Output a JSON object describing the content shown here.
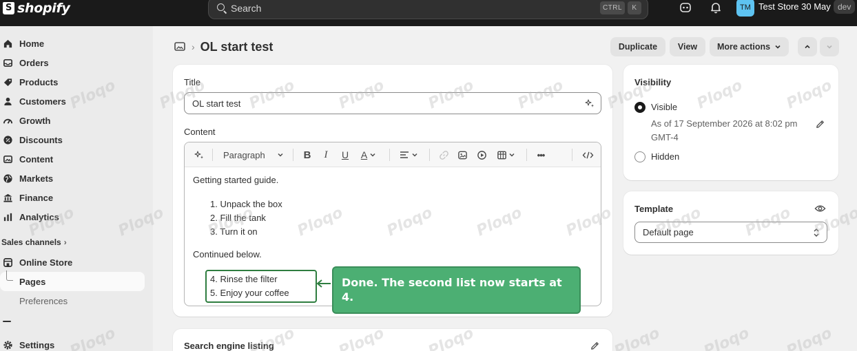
{
  "app": {
    "brand": "shopify"
  },
  "topbar": {
    "search_placeholder": "Search",
    "shortcut_ctrl": "CTRL",
    "shortcut_key": "K",
    "store_initials": "TM",
    "store_name": "Test Store 30 May",
    "badge": "dev"
  },
  "sidebar": {
    "items": [
      {
        "label": "Home",
        "icon": "home-icon"
      },
      {
        "label": "Orders",
        "icon": "inbox-icon"
      },
      {
        "label": "Products",
        "icon": "tag-icon"
      },
      {
        "label": "Customers",
        "icon": "person-icon"
      },
      {
        "label": "Growth",
        "icon": "gauge-icon"
      },
      {
        "label": "Discounts",
        "icon": "discount-icon"
      },
      {
        "label": "Content",
        "icon": "image-icon"
      },
      {
        "label": "Markets",
        "icon": "globe-icon"
      },
      {
        "label": "Finance",
        "icon": "bank-icon"
      },
      {
        "label": "Analytics",
        "icon": "bar-chart-icon"
      }
    ],
    "sales_channels": "Sales channels",
    "online_store": "Online Store",
    "pages": "Pages",
    "preferences": "Preferences",
    "settings": "Settings"
  },
  "header": {
    "title": "OL start test",
    "duplicate": "Duplicate",
    "view": "View",
    "more_actions": "More actions"
  },
  "main": {
    "title_label": "Title",
    "title_value": "OL start test",
    "content_label": "Content",
    "toolbar": {
      "paragraph": "Paragraph",
      "more": "•••"
    },
    "body": {
      "intro": "Getting started guide.",
      "list1": [
        "1. Unpack the box",
        "2. Fill the tank",
        "3. Turn it on"
      ],
      "continued": "Continued below.",
      "list2": [
        "4. Rinse the filter",
        "5. Enjoy your coffee"
      ]
    },
    "seo_title": "Search engine listing"
  },
  "visibility": {
    "title": "Visibility",
    "visible": "Visible",
    "as_of": "As of 17 September 2026 at 8:02 pm",
    "timezone": "GMT-4",
    "hidden": "Hidden"
  },
  "template": {
    "title": "Template",
    "value": "Default page"
  },
  "callout": {
    "text": "Done. The second list now starts at 4."
  },
  "watermark": "Ploqo",
  "colors": {
    "callout": "#4caf73",
    "topbar": "#1a1a1a",
    "store_avatar": "#5ec3f1"
  }
}
